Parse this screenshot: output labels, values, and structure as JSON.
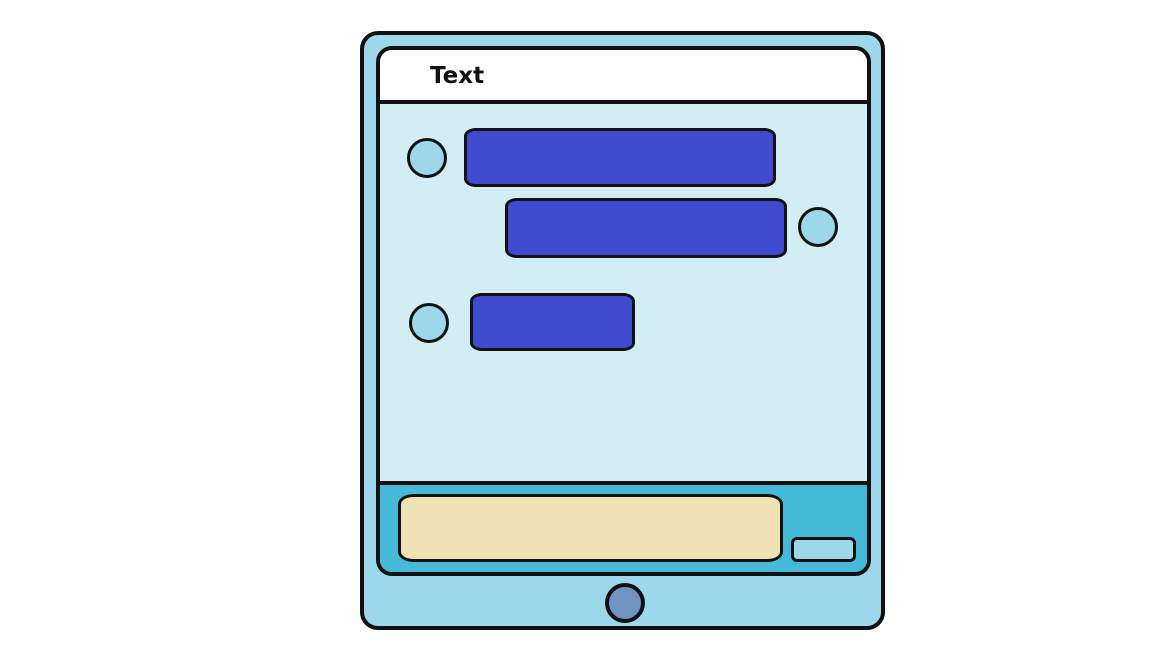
{
  "header": {
    "title": "Text"
  },
  "messages": [
    {
      "sender": "other"
    },
    {
      "sender": "self"
    },
    {
      "sender": "other"
    }
  ],
  "colors": {
    "device_frame": "#9dd8ea",
    "chat_background": "#d2edf4",
    "message_bubble": "#4149cf",
    "composer_bar": "#45bad8",
    "input_field": "#efe3b3",
    "home_button": "#7193bf",
    "outline": "#111111"
  },
  "icons": {
    "avatar": "avatar-icon",
    "home": "home-button-icon"
  }
}
